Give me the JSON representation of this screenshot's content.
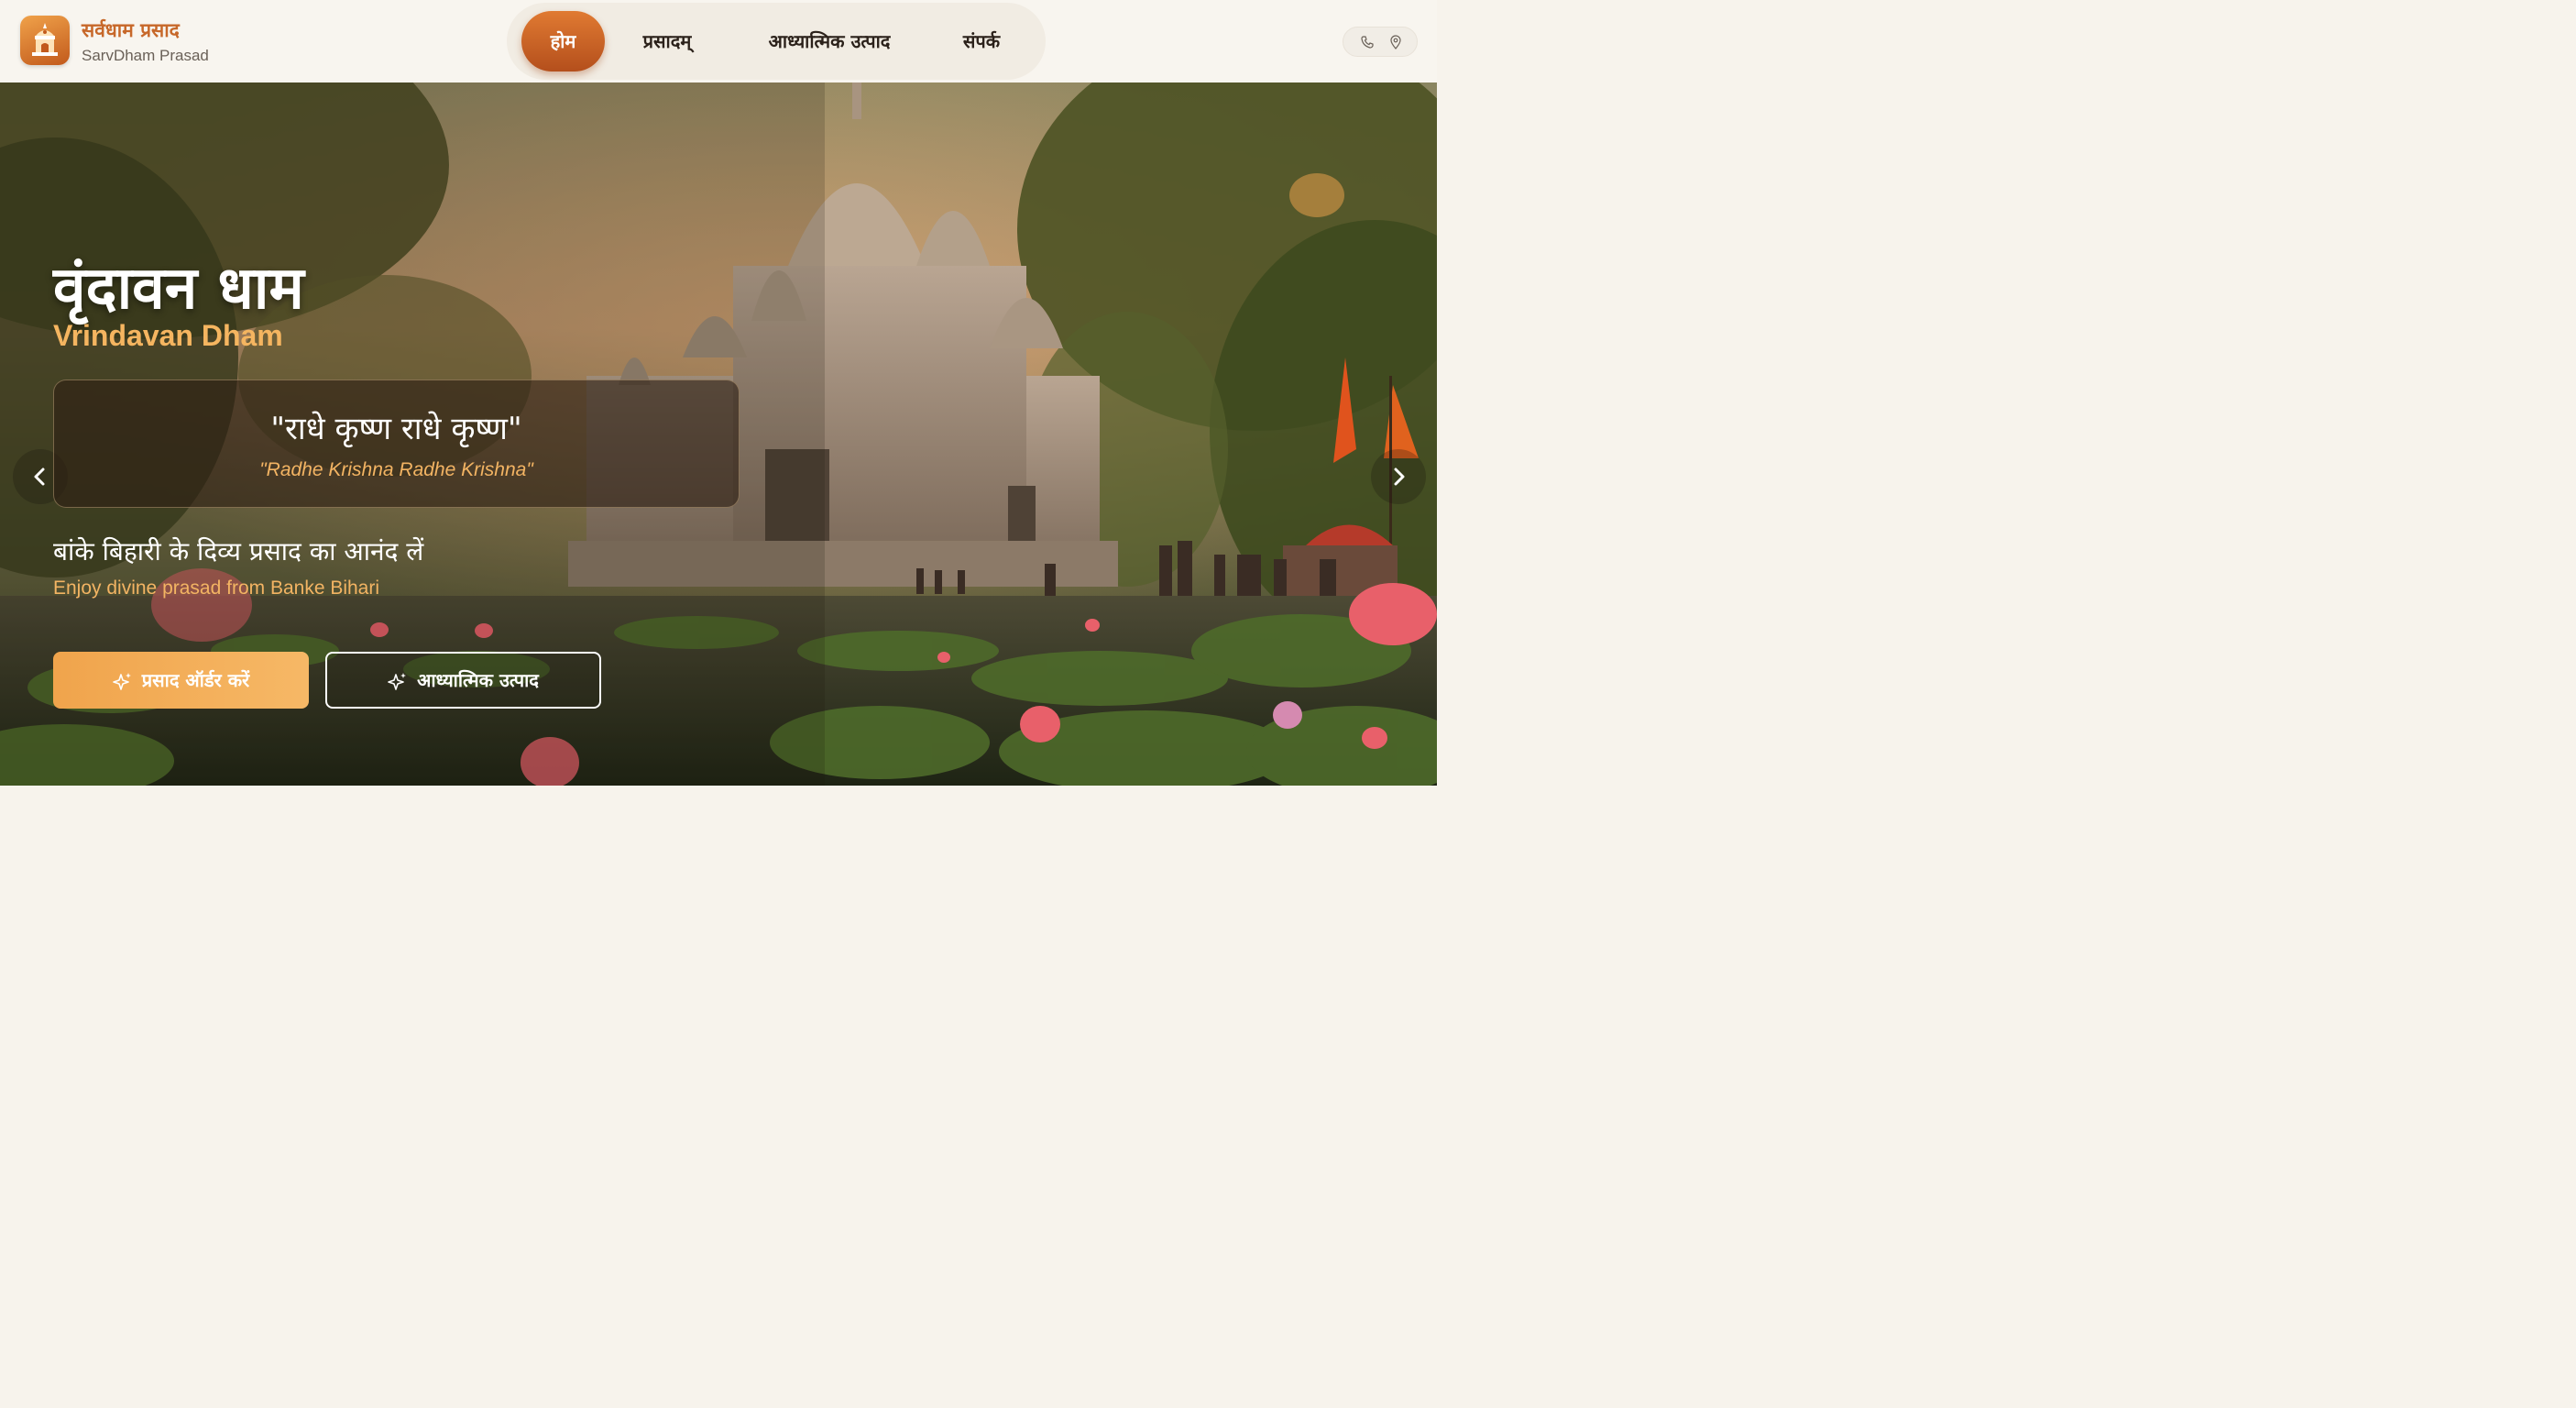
{
  "header": {
    "brand_hindi": "सर्वधाम प्रसाद",
    "brand_english": "SarvDham Prasad",
    "nav": [
      {
        "label": "होम",
        "active": true
      },
      {
        "label": "प्रसादम्",
        "active": false
      },
      {
        "label": "आध्यात्मिक उत्पाद",
        "active": false
      },
      {
        "label": "संपर्क",
        "active": false
      }
    ],
    "contact_icons": [
      "phone-icon",
      "map-pin-icon"
    ]
  },
  "hero": {
    "title_hindi": "वृंदावन धाम",
    "title_english": "Vrindavan Dham",
    "quote_hindi": "\"राधे कृष्ण राधे कृष्ण\"",
    "quote_english": "\"Radhe Krishna Radhe Krishna\"",
    "subtitle_hindi": "बांके बिहारी के दिव्य प्रसाद का आनंद लें",
    "subtitle_english": "Enjoy divine prasad from Banke Bihari",
    "primary_button": "प्रसाद ऑर्डर करें",
    "secondary_button": "आध्यात्मिक उत्पाद"
  },
  "colors": {
    "accent": "#d9702b",
    "accent_light": "#f3b463",
    "header_bg": "#f8f5ef"
  }
}
